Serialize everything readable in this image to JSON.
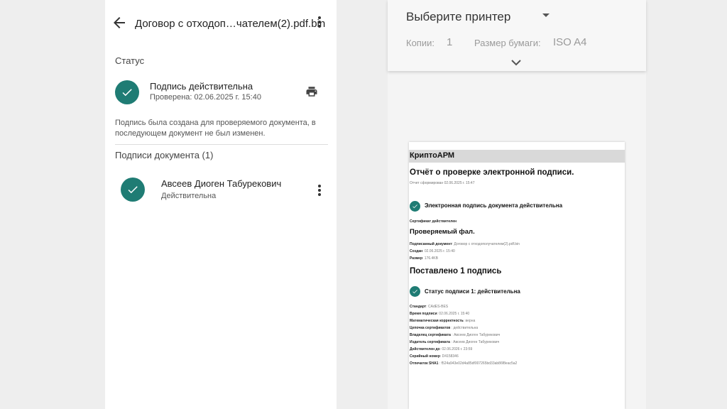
{
  "doc_view": {
    "title": "Договор с отходоп…чателем(2).pdf.bin",
    "status_section": "Статус",
    "status_title": "Подпись действительна",
    "status_checked": "Проверена: 02.06.2025 г. 15:40",
    "description": "Подпись была создана для проверяемого документа, в последующем документ не был изменен.",
    "signatures_section": "Подписи документа (1)",
    "signer_name": "Авсеев Диоген Табурекович",
    "signer_status": "Действительна"
  },
  "print_panel": {
    "printer_select": "Выберите принтер",
    "copies_label": "Копии:",
    "copies_value": "1",
    "paper_label": "Размер бумаги:",
    "paper_value": "ISO A4"
  },
  "report": {
    "brand": "КриптоАРМ",
    "title": "Отчёт о проверке электронной подписи.",
    "generated": "Отчет сформирован 02.06.2025 г. 15:47",
    "valid_line": "Электронная подпись документа действительна",
    "cert_valid": "Сертификат действителен",
    "checked_file": "Проверяемый фал.",
    "file_rows": [
      {
        "k": "Подписанный документ",
        "v": ": Договор с отходополучателем(2).pdf.bin"
      },
      {
        "k": "Создан",
        "v": ": 02.06.2025 г. 15:40"
      },
      {
        "k": "Размер",
        "v": ": 176.4KB"
      }
    ],
    "sig_count": "Поставлено 1 подпись",
    "sig_status": "Статус подписи 1: действительна",
    "sig_rows": [
      {
        "k": "Стандарт",
        "v": ": CAdES-BES"
      },
      {
        "k": "Время подписи",
        "v": ": 02.06.2025 г. 15:40"
      },
      {
        "k": "Математическая корректность",
        "v": ": верна"
      },
      {
        "k": "Цепочка сертификатов",
        "v": " : действительна"
      },
      {
        "k": "Владелец сертификата",
        "v": " : Авсеев Диоген Табурекович"
      },
      {
        "k": "Издатель сертификата",
        "v": " : Авсеев Диоген Табурекович"
      },
      {
        "k": "Действителен до",
        "v": ": 02.06.2026 г. 23:59"
      },
      {
        "k": "Серийный номер",
        "v": ": D4158346"
      },
      {
        "k": "Отпечаток SHA1",
        "v": " : f524a943e02d4a85df007265bd33ab86f8eac5a2"
      }
    ]
  },
  "colors": {
    "accent": "#1f7c74"
  }
}
